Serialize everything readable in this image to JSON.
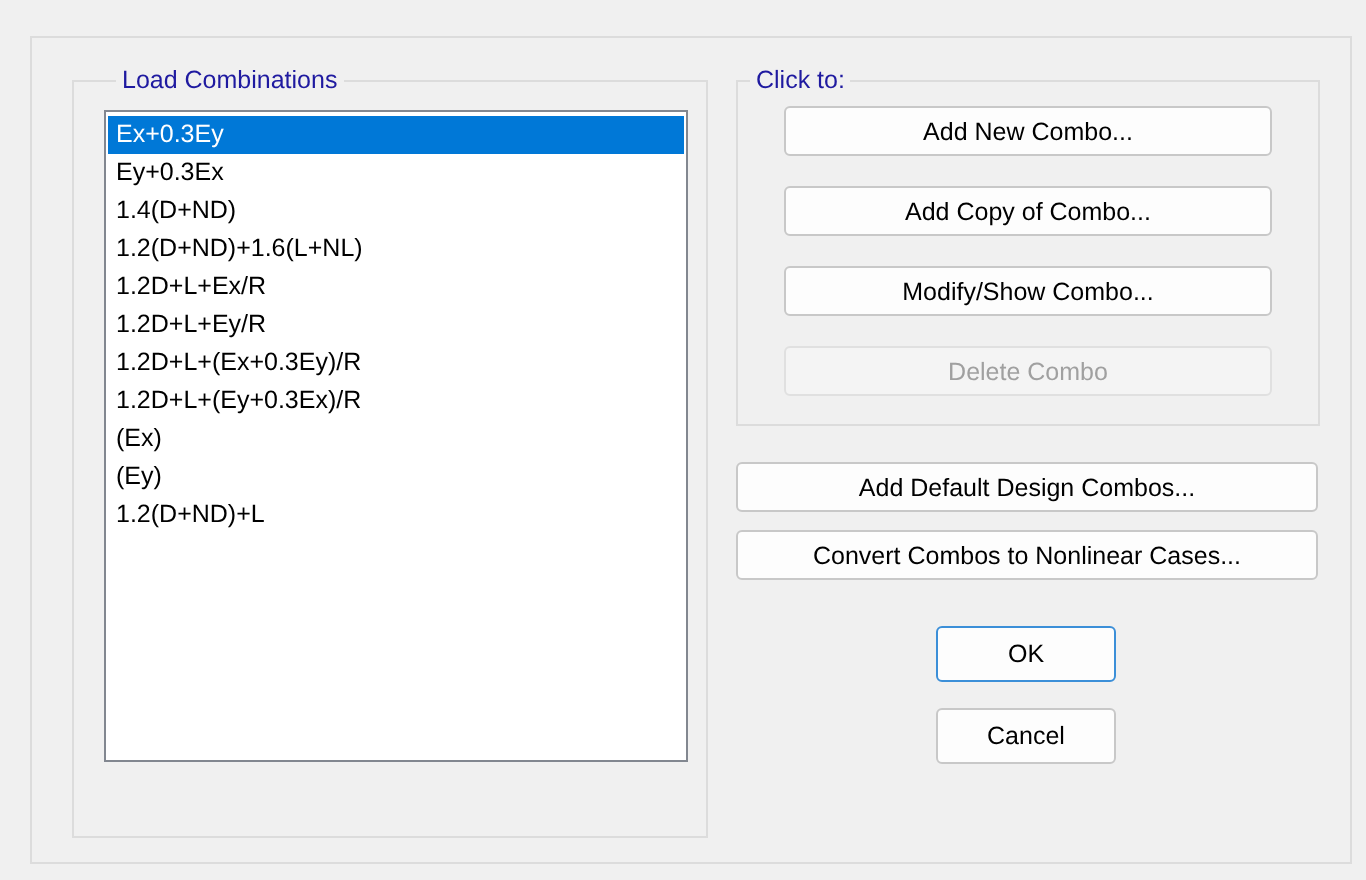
{
  "load_combinations": {
    "title": "Load Combinations",
    "items": [
      {
        "label": "Ex+0.3Ey",
        "selected": true
      },
      {
        "label": "Ey+0.3Ex",
        "selected": false
      },
      {
        "label": "1.4(D+ND)",
        "selected": false
      },
      {
        "label": "1.2(D+ND)+1.6(L+NL)",
        "selected": false
      },
      {
        "label": "1.2D+L+Ex/R",
        "selected": false
      },
      {
        "label": "1.2D+L+Ey/R",
        "selected": false
      },
      {
        "label": "1.2D+L+(Ex+0.3Ey)/R",
        "selected": false
      },
      {
        "label": "1.2D+L+(Ey+0.3Ex)/R",
        "selected": false
      },
      {
        "label": "(Ex)",
        "selected": false
      },
      {
        "label": "(Ey)",
        "selected": false
      },
      {
        "label": "1.2(D+ND)+L",
        "selected": false
      }
    ]
  },
  "click_to": {
    "title": "Click to:",
    "buttons": [
      {
        "label": "Add New Combo...",
        "disabled": false
      },
      {
        "label": "Add Copy of Combo...",
        "disabled": false
      },
      {
        "label": "Modify/Show Combo...",
        "disabled": false
      },
      {
        "label": "Delete Combo",
        "disabled": true
      }
    ]
  },
  "extra_buttons": [
    {
      "label": "Add Default Design Combos..."
    },
    {
      "label": "Convert Combos to Nonlinear Cases..."
    }
  ],
  "dialog_buttons": [
    {
      "label": "OK",
      "default": true
    },
    {
      "label": "Cancel",
      "default": false
    }
  ]
}
